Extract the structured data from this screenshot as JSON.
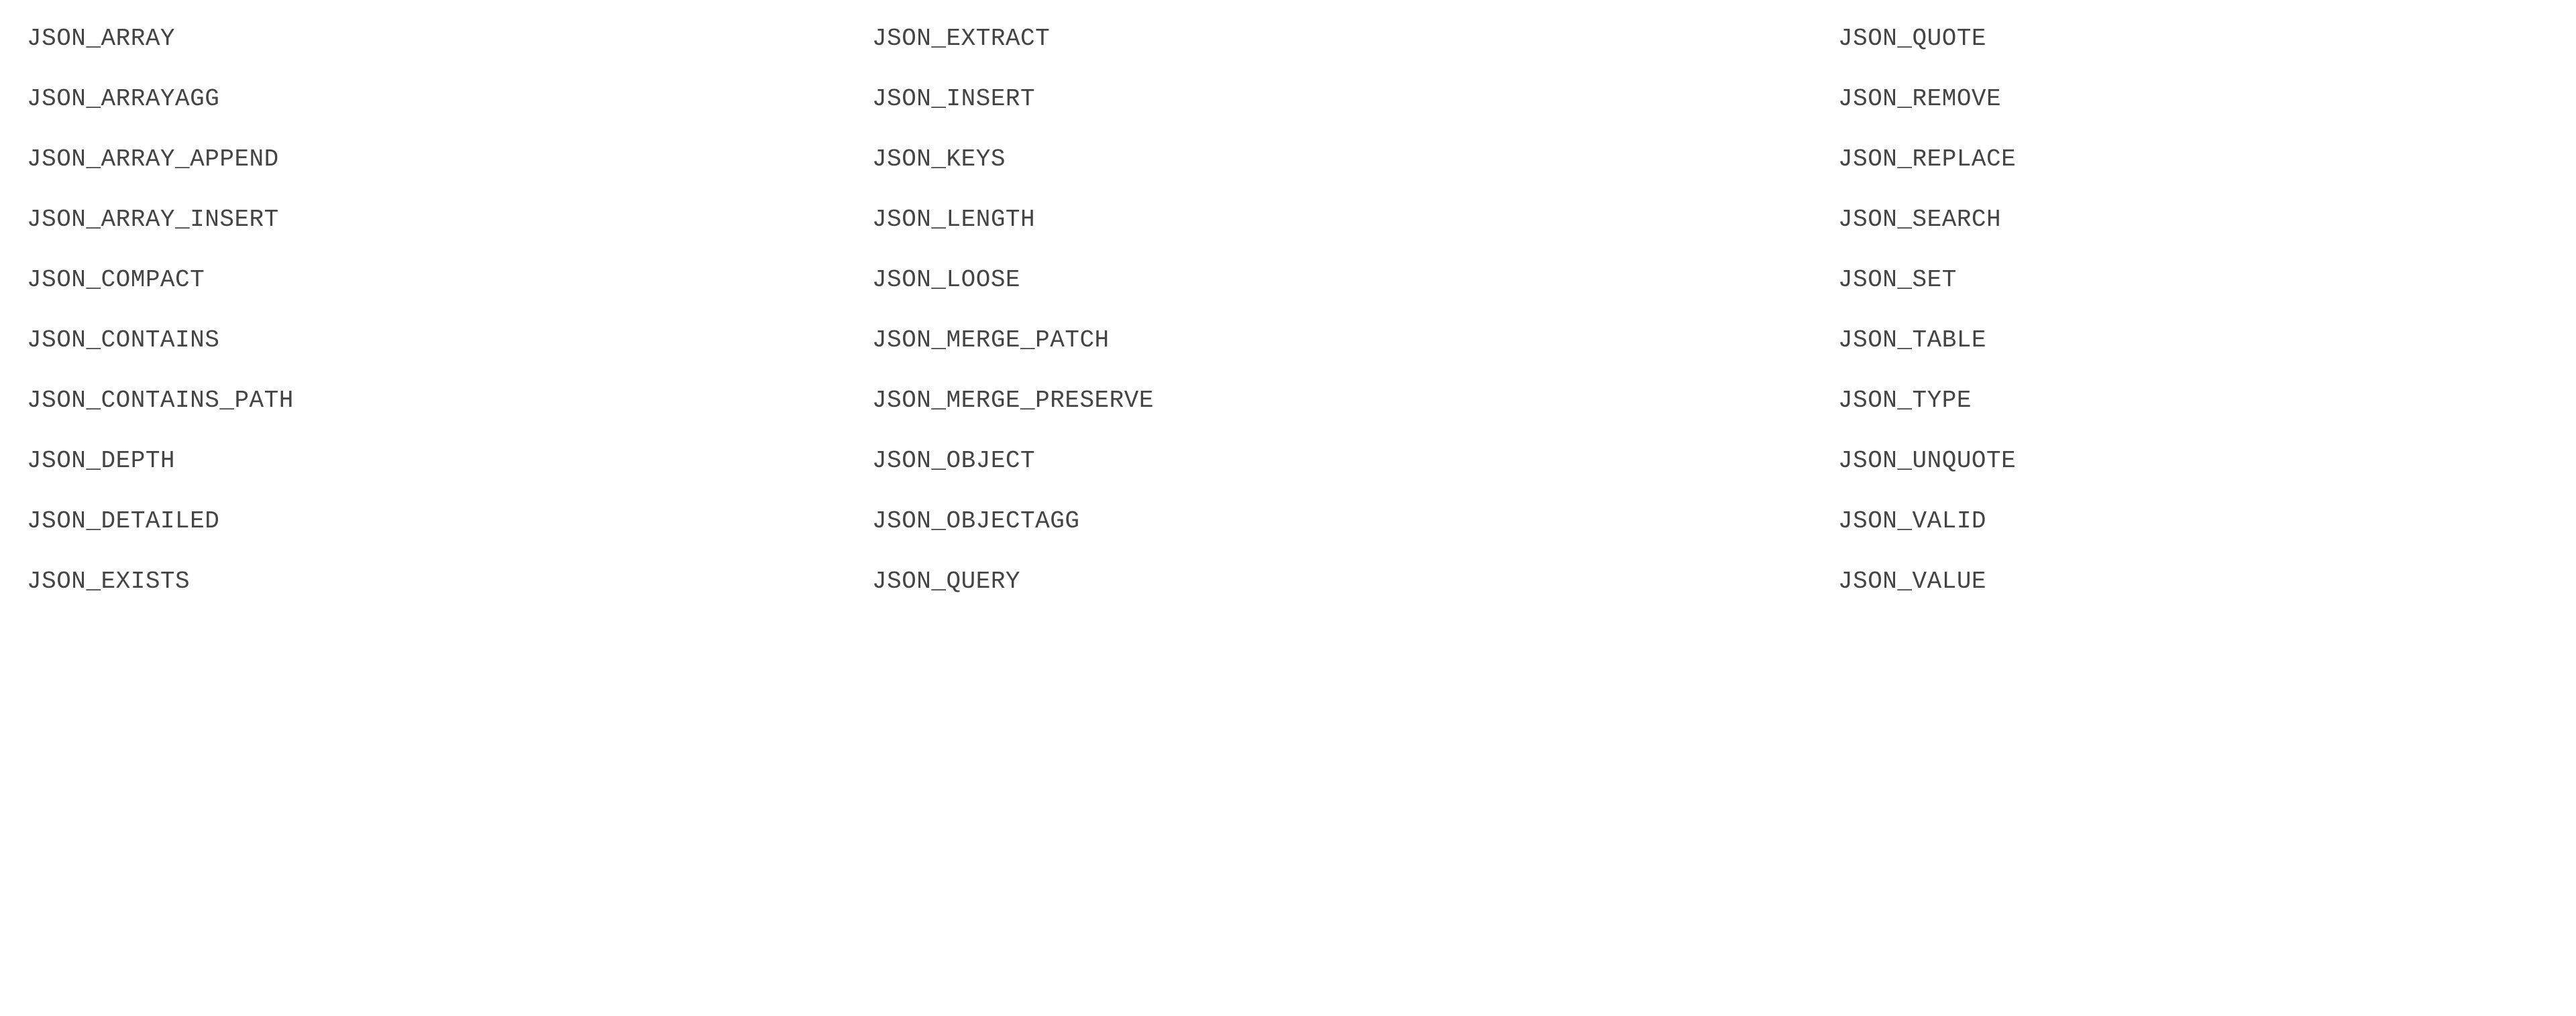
{
  "columns": [
    {
      "items": [
        "JSON_ARRAY",
        "JSON_ARRAYAGG",
        "JSON_ARRAY_APPEND",
        "JSON_ARRAY_INSERT",
        "JSON_COMPACT",
        "JSON_CONTAINS",
        "JSON_CONTAINS_PATH",
        "JSON_DEPTH",
        "JSON_DETAILED",
        "JSON_EXISTS"
      ]
    },
    {
      "items": [
        "JSON_EXTRACT",
        "JSON_INSERT",
        "JSON_KEYS",
        "JSON_LENGTH",
        "JSON_LOOSE",
        "JSON_MERGE_PATCH",
        "JSON_MERGE_PRESERVE",
        "JSON_OBJECT",
        "JSON_OBJECTAGG",
        "JSON_QUERY"
      ]
    },
    {
      "items": [
        "JSON_QUOTE",
        "JSON_REMOVE",
        "JSON_REPLACE",
        "JSON_SEARCH",
        "JSON_SET",
        "JSON_TABLE",
        "JSON_TYPE",
        "JSON_UNQUOTE",
        "JSON_VALID",
        "JSON_VALUE"
      ]
    }
  ]
}
